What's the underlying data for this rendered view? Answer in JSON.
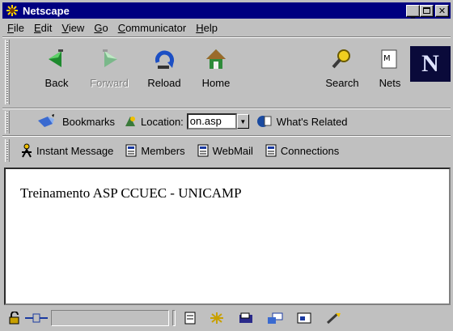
{
  "window": {
    "title": "Netscape"
  },
  "menu": [
    "File",
    "Edit",
    "View",
    "Go",
    "Communicator",
    "Help"
  ],
  "menu_access_keys": [
    "F",
    "E",
    "V",
    "G",
    "C",
    "H"
  ],
  "nav": {
    "back": "Back",
    "forward": "Forward",
    "reload": "Reload",
    "home": "Home",
    "search": "Search",
    "netscape": "Nets"
  },
  "location": {
    "bookmarks": "Bookmarks",
    "label": "Location:",
    "value": "on.asp",
    "whats_related": "What's Related"
  },
  "personal": {
    "instant_message": "Instant Message",
    "members": "Members",
    "webmail": "WebMail",
    "connections": "Connections"
  },
  "page": {
    "text": "Treinamento ASP CCUEC - UNICAMP"
  },
  "colors": {
    "title_bar": "#000080",
    "chrome": "#c0c0c0",
    "page_bg": "#ffffff"
  }
}
